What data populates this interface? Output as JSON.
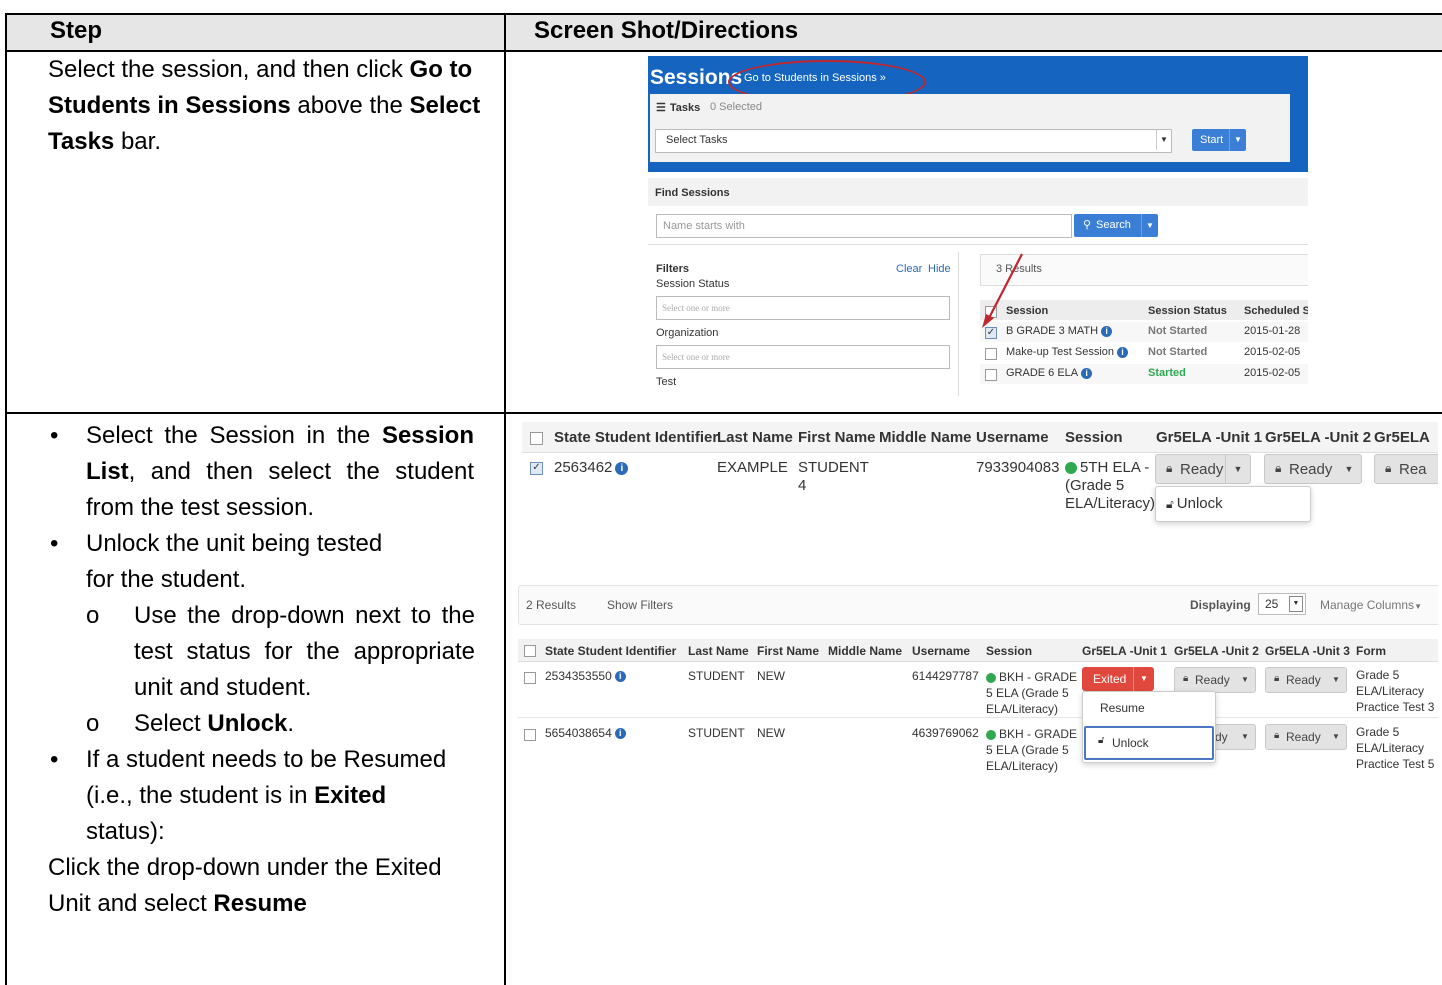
{
  "table": {
    "header_step": "Step",
    "header_directions": "Screen Shot/Directions"
  },
  "row1": {
    "text_1": "Select the session, and then click ",
    "bold_1": "Go to Students in Sessions",
    "text_2": " above the ",
    "bold_2": "Select Tasks",
    "text_3": " bar."
  },
  "row2": {
    "b1_text_1": "Select the Session in the ",
    "b1_bold": "Session List",
    "b1_text_2": ", and then select the student from the test session.",
    "b2_text": "Unlock the unit being tested for the student.",
    "s1_text": "Use the drop-down next to the test status for the appropriate unit and student.",
    "s2_text_1": "Select ",
    "s2_bold": "Unlock",
    "s2_text_2": ".",
    "b3_text_1": "If a student needs to be Resumed (i.e., the student is in ",
    "b3_bold": "Exited",
    "b3_text_2": " status):",
    "final_text_1": "Click the drop-down under the Exited Unit and select ",
    "final_bold": "Resume"
  },
  "ss1": {
    "title": "Sessions",
    "go_link": "Go to Students in Sessions »",
    "tasks_label": "Tasks",
    "tasks_count": "0 Selected",
    "select_tasks": "Select Tasks",
    "start_btn": "Start",
    "find_sessions": "Find Sessions",
    "name_placeholder": "Name starts with",
    "search_btn": "Search",
    "filters_label": "Filters",
    "clear_link": "Clear",
    "hide_link": "Hide",
    "session_status_label": "Session Status",
    "select_one_1": "Select one or more",
    "organization_label": "Organization",
    "select_one_2": "Select one or more",
    "test_label": "Test",
    "results_count": "3 Results",
    "col_session": "Session",
    "col_status": "Session Status",
    "col_scheduled": "Scheduled S",
    "rows": [
      {
        "session": "B GRADE 3 MATH",
        "status": "Not Started",
        "date": "2015-01-28",
        "checked": true
      },
      {
        "session": "Make-up Test Session",
        "status": "Not Started",
        "date": "2015-02-05",
        "checked": false
      },
      {
        "session": "GRADE 6 ELA",
        "status": "Started",
        "date": "2015-02-05",
        "checked": false
      }
    ]
  },
  "ss2": {
    "headers": [
      "State Student Identifier",
      "Last Name",
      "First Name",
      "Middle Name",
      "Username",
      "Session",
      "Gr5ELA -Unit 1",
      "Gr5ELA -Unit 2",
      "Gr5ELA"
    ],
    "ssid": "2563462",
    "last": "EXAMPLE",
    "first": "STUDENT",
    "first_2": "4",
    "username": "7933904083",
    "session_1": "5TH ELA -",
    "session_2": "(Grade 5",
    "session_3": "ELA/Literacy)",
    "ready_1": "Ready",
    "ready_2": "Ready",
    "ready_3": "Rea",
    "unlock": "Unlock"
  },
  "ss3": {
    "results": "2 Results",
    "show_filters": "Show Filters",
    "displaying": "Displaying",
    "per_page": "25",
    "manage_columns": "Manage Columns",
    "headers": [
      "State Student Identifier",
      "Last Name",
      "First Name",
      "Middle Name",
      "Username",
      "Session",
      "Gr5ELA -Unit 1",
      "Gr5ELA -Unit 2",
      "Gr5ELA -Unit 3",
      "Form"
    ],
    "rows": [
      {
        "ssid": "2534353550",
        "last": "STUDENT",
        "first": "NEW",
        "username": "6144297787",
        "s1": "BKH - GRADE",
        "s2": "5 ELA (Grade 5",
        "s3": "ELA/Literacy)",
        "u1": "Exited",
        "u2": "Ready",
        "u3": "Ready",
        "f1": "Grade 5",
        "f2": "ELA/Literacy",
        "f3": "Practice Test 3"
      },
      {
        "ssid": "5654038654",
        "last": "STUDENT",
        "first": "NEW",
        "username": "4639769062",
        "s1": "BKH - GRADE",
        "s2": "5 ELA (Grade 5",
        "s3": "ELA/Literacy)",
        "u1": "",
        "u2": "dy",
        "u3": "Ready",
        "f1": "Grade 5",
        "f2": "ELA/Literacy",
        "f3": "Practice Test 5"
      }
    ],
    "menu_resume": "Resume",
    "menu_unlock": "Unlock"
  },
  "colors": {
    "header_bg": "#e6e6e6",
    "sessions_blue": "#1565c0",
    "button_blue": "#3a7fd5",
    "exited_red": "#e0483e",
    "started_green": "#2fa84f",
    "annotation_red": "#c0262d"
  }
}
